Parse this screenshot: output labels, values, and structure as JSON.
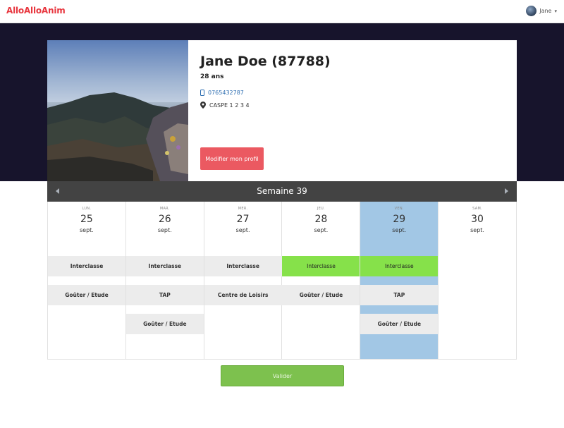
{
  "navbar": {
    "brand": "AlloAlloAnim",
    "user_name": "Jane"
  },
  "profile": {
    "name": "Jane Doe (87788)",
    "age": "28 ans",
    "phone": "0765432787",
    "location": "CASPE 1 2 3 4",
    "edit_label": "Modifier mon profil"
  },
  "week": {
    "title": "Semaine 39"
  },
  "days": [
    {
      "abbr": "LUN.",
      "num": "25",
      "month": "sept.",
      "today": false,
      "slots": [
        {
          "label": "Interclasse",
          "selected": false
        },
        {
          "label": "Goûter / Etude",
          "selected": false
        }
      ]
    },
    {
      "abbr": "MAR.",
      "num": "26",
      "month": "sept.",
      "today": false,
      "slots": [
        {
          "label": "Interclasse",
          "selected": false
        },
        {
          "label": "TAP",
          "selected": false
        },
        {
          "label": "Goûter / Etude",
          "selected": false
        }
      ]
    },
    {
      "abbr": "MER.",
      "num": "27",
      "month": "sept.",
      "today": false,
      "slots": [
        {
          "label": "Interclasse",
          "selected": false
        },
        {
          "label": "Centre de Loisirs",
          "selected": false
        }
      ]
    },
    {
      "abbr": "JEU.",
      "num": "28",
      "month": "sept.",
      "today": false,
      "slots": [
        {
          "label": "Interclasse",
          "selected": true
        },
        {
          "label": "Goûter / Etude",
          "selected": false
        }
      ]
    },
    {
      "abbr": "VEN.",
      "num": "29",
      "month": "sept.",
      "today": true,
      "slots": [
        {
          "label": "Interclasse",
          "selected": true
        },
        {
          "label": "TAP",
          "selected": false
        },
        {
          "label": "Goûter / Etude",
          "selected": false
        }
      ]
    },
    {
      "abbr": "SAM.",
      "num": "30",
      "month": "sept.",
      "today": false,
      "slots": []
    }
  ],
  "submit_label": "Valider",
  "colors": {
    "brand": "#e8373f",
    "hero": "#17142c",
    "edit_button": "#eb5961",
    "selected_slot": "#86e14a",
    "today": "#a2c7e5",
    "submit": "#7dc14e"
  }
}
